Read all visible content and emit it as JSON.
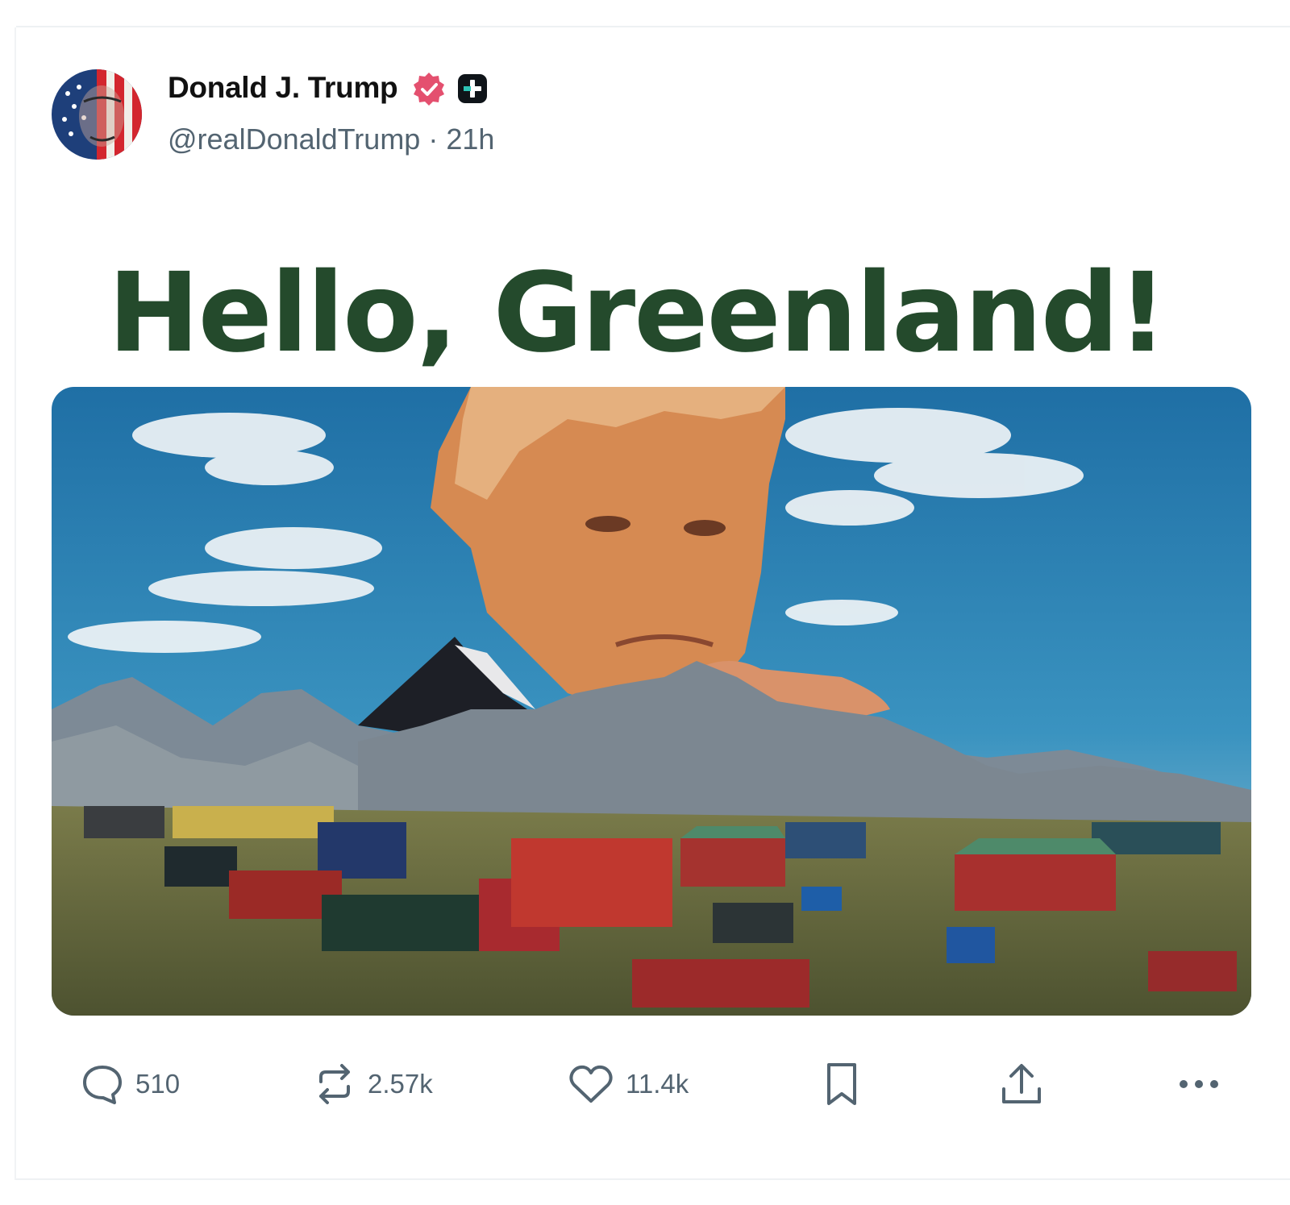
{
  "post": {
    "display_name": "Donald J. Trump",
    "handle": "@realDonaldTrump",
    "separator": "·",
    "time": "21h",
    "headline": "Hello, Greenland!",
    "headline_color": "#244a2c"
  },
  "actions": {
    "replies": "510",
    "reposts": "2.57k",
    "likes": "11.4k"
  },
  "icons": [
    "verified-badge-icon",
    "plus-badge-icon",
    "reply-icon",
    "repost-icon",
    "like-icon",
    "bookmark-icon",
    "share-icon",
    "more-icon"
  ],
  "colors": {
    "accent_badge": "#e4506f",
    "text_secondary": "#536471",
    "sky": "#2f86b8"
  }
}
